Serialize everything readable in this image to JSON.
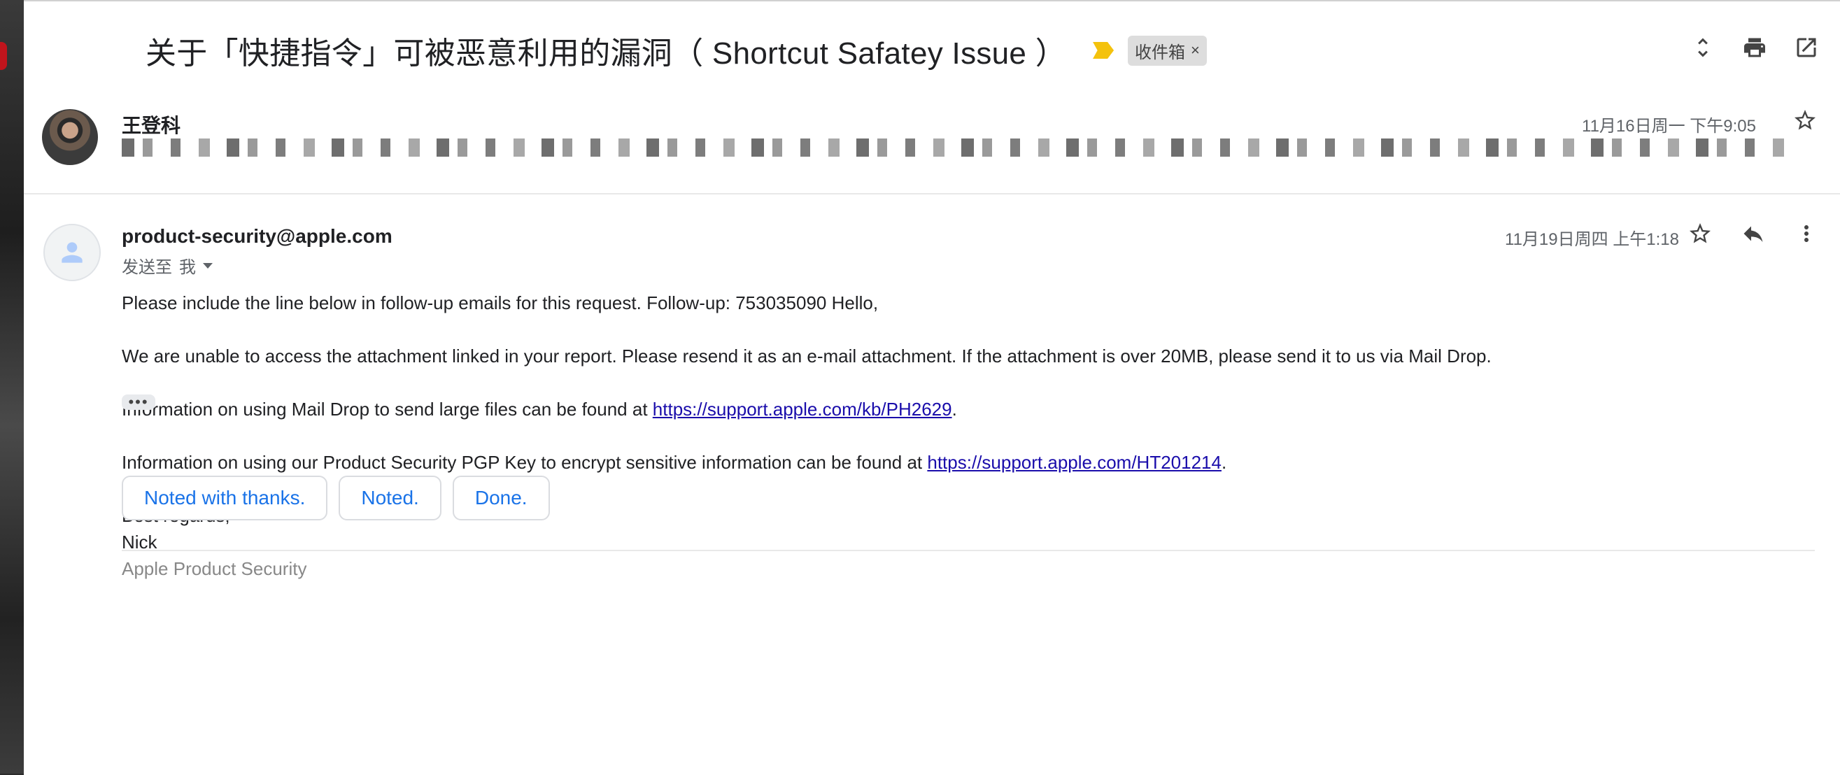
{
  "thread": {
    "subject": "关于「快捷指令」可被恶意利用的漏洞（ Shortcut Safatey Issue ）",
    "label": "收件箱",
    "label_remove": "×"
  },
  "message1": {
    "sender": "王登科",
    "date": "11月16日周一 下午9:05"
  },
  "message2": {
    "sender": "product-security@apple.com",
    "to_prefix": "发送至",
    "to_value": "我",
    "date": "11月19日周四 上午1:18",
    "body": {
      "p1": "Please include the line below in follow-up emails for this request. Follow-up: 753035090 Hello,",
      "p2": "We are unable to access the attachment linked in your report. Please resend it as an e-mail attachment. If the attachment is over 20MB, please send it to us via Mail Drop.",
      "p3_text": "Information on using Mail Drop to send large files can be found at ",
      "p3_link": "https://support.apple.com/kb/PH2629",
      "p3_end": ".",
      "p4_text": "Information on using our Product Security PGP Key to encrypt sensitive information can be found at ",
      "p4_link": "https://support.apple.com/HT201214",
      "p4_end": ".",
      "sig_line1": "Best regards,",
      "sig_line2": "Nick",
      "sig_line3": "Apple Product Security"
    },
    "trimmed": "•••"
  },
  "smart_replies": [
    "Noted with thanks.",
    "Noted.",
    "Done."
  ],
  "colors": {
    "link": "#1a0dab",
    "smart_reply": "#1a73e8",
    "importance": "#f4c20d"
  },
  "icons": [
    "expand-collapse-icon",
    "print-icon",
    "open-in-new-window-icon",
    "star-icon",
    "reply-icon",
    "more-vert-icon",
    "person-icon"
  ]
}
